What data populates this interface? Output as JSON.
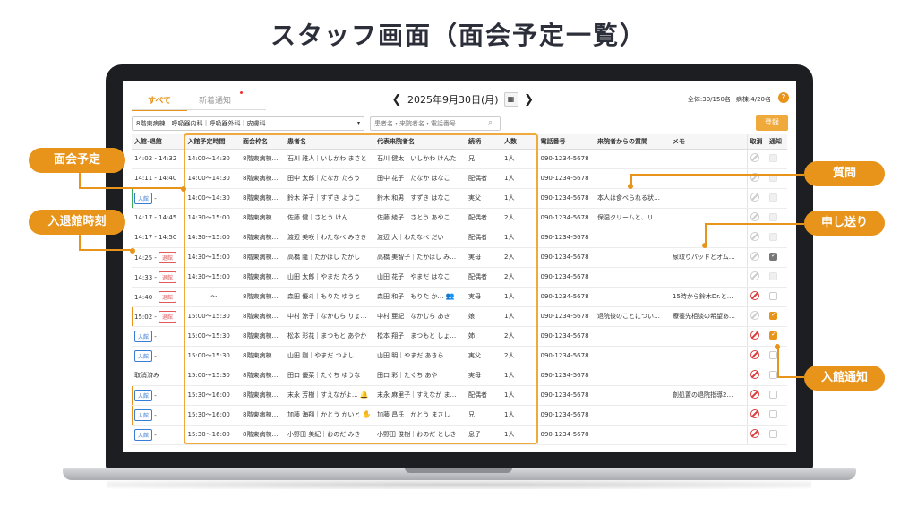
{
  "headline": "スタッフ画面（面会予定一覧）",
  "tabs": [
    {
      "label": "すべて",
      "active": true
    },
    {
      "label": "新着通知",
      "active": false
    }
  ],
  "date": {
    "prev": "❮",
    "label": "2025年9月30日(月)",
    "next": "❯",
    "calendar_icon": "calendar-icon"
  },
  "counts": {
    "total": "全体:30/150名",
    "ward": "病棟:4/20名"
  },
  "help_label": "?",
  "filter": {
    "value": "8階東病棟　呼吸器内科｜呼吸器外科｜皮膚科",
    "caret": "▾"
  },
  "search": {
    "placeholder": "患者名・来院者名・電話番号",
    "icon": "⌕"
  },
  "register_label": "登録",
  "columns": [
    "入館-退館",
    "入館予定時間",
    "面会枠名",
    "患者名",
    "代表来院者名",
    "続柄",
    "人数",
    "電話番号",
    "来院者からの質問",
    "メモ",
    "取消",
    "通知"
  ],
  "rows": [
    {
      "inout": "14:02 - 14:32",
      "badge": "",
      "badge_type": "",
      "sched": "14:00～14:30",
      "slot": "8階東病棟…",
      "patient": "石川 雅人｜いしかわ まさと",
      "visitor": "石川 健太｜いしかわ けんた",
      "vicon": "",
      "rel": "兄",
      "num": "1人",
      "phone": "090-1234-5678",
      "q": "",
      "memo": "",
      "cancel": "gray",
      "notify": "dim",
      "bar": ""
    },
    {
      "inout": "14:11 - 14:40",
      "badge": "",
      "badge_type": "",
      "sched": "14:00～14:30",
      "slot": "8階東病棟…",
      "patient": "田中 太郎｜たなか たろう",
      "visitor": "田中 花子｜たなか はなこ",
      "vicon": "",
      "rel": "配偶者",
      "num": "1人",
      "phone": "090-1234-5678",
      "q": "",
      "memo": "",
      "cancel": "gray",
      "notify": "dim",
      "bar": ""
    },
    {
      "inout": "",
      "badge": "入館",
      "badge_type": "in",
      "tail": " -",
      "sched": "14:00～14:30",
      "slot": "8階東病棟…",
      "patient": "鈴木 洋子｜すずき ようこ",
      "visitor": "鈴木 和男｜すずき はなこ",
      "vicon": "",
      "rel": "実父",
      "num": "1人",
      "phone": "090-1234-5678",
      "q": "本人は食べられる状…",
      "memo": "",
      "cancel": "gray",
      "notify": "dim",
      "bar": "green"
    },
    {
      "inout": "14:17 - 14:45",
      "badge": "",
      "badge_type": "",
      "sched": "14:30～15:00",
      "slot": "8階東病棟…",
      "patient": "佐藤 健｜さとう けん",
      "visitor": "佐藤 綾子｜さとう あやこ",
      "vicon": "",
      "rel": "配偶者",
      "num": "2人",
      "phone": "090-1234-5678",
      "q": "保湿クリームと、リ…",
      "memo": "",
      "cancel": "gray",
      "notify": "dim",
      "bar": ""
    },
    {
      "inout": "14:17 - 14:50",
      "badge": "",
      "badge_type": "",
      "sched": "14:30～15:00",
      "slot": "8階東病棟…",
      "patient": "渡辺 美咲｜わたなべ みさき",
      "visitor": "渡辺 大｜わたなべ だい",
      "vicon": "",
      "rel": "配偶者",
      "num": "1人",
      "phone": "090-1234-5678",
      "q": "",
      "memo": "",
      "cancel": "gray",
      "notify": "dim",
      "bar": ""
    },
    {
      "inout": "14:25 -",
      "badge": "退館",
      "badge_type": "out",
      "sched": "14:30～15:00",
      "slot": "8階東病棟…",
      "patient": "高橋 隆｜たかはし たかし",
      "visitor": "高橋 美智子｜たかはし み…",
      "vicon": "",
      "rel": "実母",
      "num": "2人",
      "phone": "090-1234-5678",
      "q": "",
      "memo": "尿取りパッドとオム…",
      "cancel": "gray",
      "notify": "gray",
      "bar": ""
    },
    {
      "inout": "14:33 -",
      "badge": "退館",
      "badge_type": "out",
      "sched": "14:30～15:00",
      "slot": "8階東病棟…",
      "patient": "山田 太郎｜やまだ たろう",
      "visitor": "山田 花子｜やまだ はなこ",
      "vicon": "",
      "rel": "配偶者",
      "num": "2人",
      "phone": "090-1234-5678",
      "q": "",
      "memo": "",
      "cancel": "gray",
      "notify": "dim",
      "bar": ""
    },
    {
      "inout": "14:40 -",
      "badge": "退館",
      "badge_type": "out",
      "sched": "～",
      "slot": "8階東病棟…",
      "patient": "森田 優斗｜もりた ゆうと",
      "visitor": "森田 和子｜もりた か…",
      "vicon": "👥",
      "rel": "実母",
      "num": "1人",
      "phone": "090-1234-5678",
      "q": "",
      "memo": "15時から鈴木Dr.と…",
      "cancel": "red",
      "notify": "off",
      "bar": ""
    },
    {
      "inout": "15:02 -",
      "badge": "退館",
      "badge_type": "out",
      "sched": "15:00～15:30",
      "slot": "8階東病棟…",
      "patient": "中村 涼子｜なかむら りょ…",
      "visitor": "中村 亜紀｜なかむら あき",
      "vicon": "",
      "rel": "娘",
      "num": "1人",
      "phone": "090-1234-5678",
      "q": "退院後のことについ…",
      "memo": "療養先相談の希望あ…",
      "cancel": "gray",
      "notify": "on",
      "bar": "orange"
    },
    {
      "inout": "",
      "badge": "入館",
      "badge_type": "in",
      "tail": " -",
      "sched": "15:00～15:30",
      "slot": "8階東病棟…",
      "patient": "松本 彩花｜まつもと あやか",
      "visitor": "松本 翔子｜まつもと しょ…",
      "vicon": "",
      "rel": "姉",
      "num": "2人",
      "phone": "090-1234-5678",
      "q": "",
      "memo": "",
      "cancel": "red",
      "notify": "on",
      "bar": ""
    },
    {
      "inout": "",
      "badge": "入館",
      "badge_type": "in",
      "tail": " -",
      "sched": "15:00～15:30",
      "slot": "8階東病棟…",
      "patient": "山田 剛｜やまだ つよし",
      "visitor": "山田 明｜やまだ あきら",
      "vicon": "",
      "rel": "実父",
      "num": "2人",
      "phone": "090-1234-5678",
      "q": "",
      "memo": "",
      "cancel": "red",
      "notify": "off",
      "bar": ""
    },
    {
      "inout": "取消済み",
      "badge": "",
      "badge_type": "",
      "sched": "15:00～15:30",
      "slot": "8階東病棟…",
      "patient": "田口 優菜｜たぐち ゆうな",
      "visitor": "田口 彩｜たぐち あや",
      "vicon": "",
      "rel": "実母",
      "num": "1人",
      "phone": "090-1234-5678",
      "q": "",
      "memo": "",
      "cancel": "red",
      "notify": "off",
      "bar": ""
    },
    {
      "inout": "",
      "badge": "入館",
      "badge_type": "in",
      "tail": " -",
      "sched": "15:30～16:00",
      "slot": "8階東病棟…",
      "patient": "末永 芳樹｜すえながよ…",
      "picon": "🔔",
      "visitor": "末永 麻里子｜すえなが ま…",
      "vicon": "",
      "rel": "配偶者",
      "num": "1人",
      "phone": "090-1234-5678",
      "q": "",
      "memo": "創処置の退院指導2…",
      "cancel": "red",
      "notify": "off",
      "bar": "orange"
    },
    {
      "inout": "",
      "badge": "入館",
      "badge_type": "in",
      "tail": " -",
      "sched": "15:30～16:00",
      "slot": "8階東病棟…",
      "patient": "加藤 海翔｜かとう かいと",
      "picon": "✋",
      "visitor": "加藤 昌氏｜かとう まさし",
      "vicon": "",
      "rel": "兄",
      "num": "1人",
      "phone": "090-1234-5678",
      "q": "",
      "memo": "",
      "cancel": "red",
      "notify": "off",
      "bar": "orange"
    },
    {
      "inout": "",
      "badge": "入館",
      "badge_type": "in",
      "tail": " -",
      "sched": "15:30～16:00",
      "slot": "8階東病棟…",
      "patient": "小野田 美紀｜おのだ みき",
      "visitor": "小野田 俊樹｜おのだ としき",
      "vicon": "",
      "rel": "息子",
      "num": "1人",
      "phone": "090-1234-5678",
      "q": "",
      "memo": "",
      "cancel": "red",
      "notify": "off",
      "bar": ""
    }
  ],
  "callouts": {
    "visit_schedule": "面会予定",
    "entry_exit_time": "入退館時刻",
    "question": "質問",
    "handover": "申し送り",
    "entry_notice": "入館通知"
  },
  "colors": {
    "accent": "#e8931a",
    "enter": "#3a7bd5",
    "exit": "#e0585a",
    "cancel": "#d93c3c"
  }
}
